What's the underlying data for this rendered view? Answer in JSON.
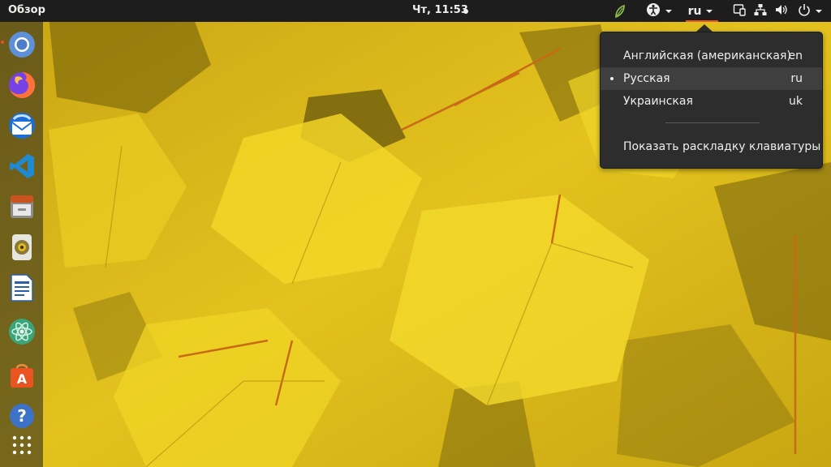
{
  "topbar": {
    "activities": "Обзор",
    "clock": "Чт, 11:53",
    "language_short": "ru"
  },
  "icons": {
    "network_app": "leaf-network-icon",
    "accessibility": "accessibility-icon",
    "display": "display-icon",
    "network": "network-wired-icon",
    "volume": "volume-icon",
    "power": "power-icon"
  },
  "dock": {
    "apps": [
      {
        "name": "chromium-icon"
      },
      {
        "name": "firefox-icon"
      },
      {
        "name": "thunderbird-icon"
      },
      {
        "name": "vscode-icon"
      },
      {
        "name": "files-icon"
      },
      {
        "name": "rhythmbox-icon"
      },
      {
        "name": "libreoffice-writer-icon"
      },
      {
        "name": "atom-icon"
      },
      {
        "name": "software-center-icon"
      },
      {
        "name": "help-icon"
      },
      {
        "name": "show-applications-icon"
      }
    ]
  },
  "language_menu": {
    "items": [
      {
        "label": "Английская (американская)",
        "code": "en",
        "active": false
      },
      {
        "label": "Русская",
        "code": "ru",
        "active": true
      },
      {
        "label": "Украинская",
        "code": "uk",
        "active": false
      }
    ],
    "show_layout": "Показать раскладку клавиатуры"
  },
  "colors": {
    "accent": "#e95420",
    "topbar_bg": "#1d1d1d",
    "menu_bg": "#2d2d2d",
    "wallpaper_yellow": "#e8c418"
  }
}
